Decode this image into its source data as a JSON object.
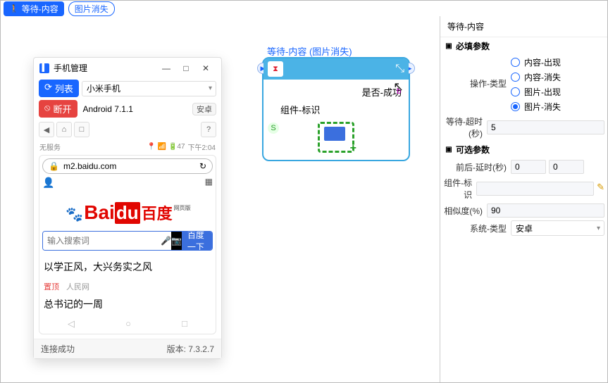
{
  "topbar": {
    "tag_primary": "等待-内容",
    "tag_outline": "图片消失"
  },
  "phone": {
    "title": "手机管理",
    "list_btn": "列表",
    "device_select": "小米手机",
    "disconnect_btn": "断开",
    "os_text": "Android 7.1.1",
    "os_pill": "安卓",
    "status_noservice": "无服务",
    "status_time": "下午2:04",
    "url": "m2.baidu.com",
    "logo_bai": "Bai",
    "logo_du": "du",
    "logo_zh": "百度",
    "logo_web": "网页版",
    "search_placeholder": "输入搜索词",
    "search_btn": "百度一下",
    "news1": "以学正风，大兴务实之风",
    "news1_pin": "置顶",
    "news1_src": "人民网",
    "news2": "总书记的一周",
    "footer_status": "连接成功",
    "footer_version": "版本: 7.3.2.7"
  },
  "node": {
    "header": "等待-内容 (图片消失)",
    "out_label": "是否-成功",
    "in_label": "组件-标识"
  },
  "panel": {
    "tab": "等待-内容",
    "section_required": "必填参数",
    "op_label": "操作-类型",
    "ops": [
      "内容-出现",
      "内容-消失",
      "图片-出现",
      "图片-消失"
    ],
    "op_selected": 3,
    "timeout_label": "等待-超时(秒)",
    "timeout_val": "5",
    "section_optional": "可选参数",
    "delay_label": "前后-延时(秒)",
    "delay_a": "0",
    "delay_b": "0",
    "comp_label": "组件-标识",
    "comp_val": "",
    "sim_label": "相似度(%)",
    "sim_val": "90",
    "sys_label": "系统-类型",
    "sys_val": "安卓"
  }
}
